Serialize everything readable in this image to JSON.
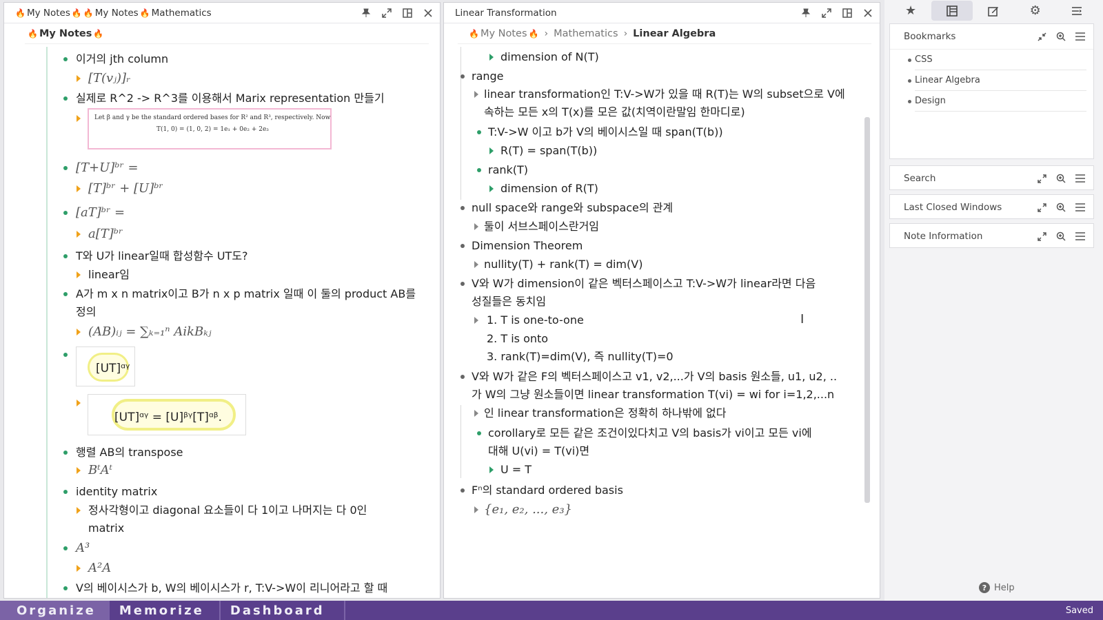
{
  "left_panel": {
    "title_parts": [
      "My Notes",
      "My Notes",
      "Mathematics"
    ],
    "breadcrumb": "My Notes",
    "rows": [
      {
        "text": "이거의 jth column"
      },
      {
        "text": "[T(vⱼ)]ᵣ"
      },
      {
        "text": "실제로 R^2 -> R^3를 이용해서 Marix representation 만들기"
      },
      {
        "text": "Let β and γ be the standard ordered bases for R² and R³, respectively. Now"
      },
      {
        "text": "T(1, 0) = (1, 0, 2) = 1e₁ + 0e₂ + 2e₃"
      },
      {
        "text": "[T+U]ᵇʳ ="
      },
      {
        "text": "[T]ᵇʳ + [U]ᵇʳ"
      },
      {
        "text": "[aT]ᵇʳ ="
      },
      {
        "text": "a[T]ᵇʳ"
      },
      {
        "text": "T와 U가 linear일때 합성함수 UT도?"
      },
      {
        "text": "linear임"
      },
      {
        "text": "A가 m x n matrix이고 B가 n x p matrix 일때 이 둘의 product AB를"
      },
      {
        "text": "정의"
      },
      {
        "text": "(AB)ᵢⱼ = ∑ₖ₌₁ⁿ AikBₖⱼ"
      },
      {
        "text": "[UT]ᵅᵞ"
      },
      {
        "text": "[UT]ᵅᵞ = [U]ᵝᵞ[T]ᵅᵝ."
      },
      {
        "text": "행렬 AB의 transpose"
      },
      {
        "text": "BᵗAᵗ"
      },
      {
        "text": "identity matrix"
      },
      {
        "text": "정사각형이고 diagonal 요소들이 다 1이고 나머지는 다 0인"
      },
      {
        "text": "matrix"
      },
      {
        "text": "A³"
      },
      {
        "text": "A²A"
      },
      {
        "text": "V의 베이시스가 b, W의 베이시스가 r, T:V->W이 리니어라고 할 때"
      }
    ]
  },
  "mid_panel": {
    "title": "Linear Transformation",
    "breadcrumb": {
      "root": "My Notes",
      "mid": "Mathematics",
      "current": "Linear Algebra"
    },
    "rows": [
      {
        "text": "dimension of N(T)"
      },
      {
        "text": "range"
      },
      {
        "text": "linear transformation인 T:V->W가 있을 때 R(T)는 W의 subset으로 V에"
      },
      {
        "text": "속하는 모든 x의 T(x)를 모은 값(치역이란말임 한마디로)"
      },
      {
        "text": "T:V->W 이고 b가 V의 베이시스일 때 span(T(b))"
      },
      {
        "text": "R(T) = span(T(b))"
      },
      {
        "text": "rank(T)"
      },
      {
        "text": "dimension of R(T)"
      },
      {
        "text": "null space와 range와 subspace의 관계"
      },
      {
        "text": "둘이 서브스페이스란거임"
      },
      {
        "text": "Dimension Theorem"
      },
      {
        "text": "nullity(T) + rank(T) = dim(V)"
      },
      {
        "text": "V와 W가 dimension이 같은 벡터스페이스고 T:V->W가 linear라면 다음"
      },
      {
        "text": "성질들은 동치임"
      },
      {
        "text": "1. T is one-to-one"
      },
      {
        "text": "2. T is onto"
      },
      {
        "text": "3. rank(T)=dim(V), 즉 nullity(T)=0"
      },
      {
        "text": "V와 W가 같은 F의 벡터스페이스고 v1, v2,...가 V의 basis 원소들, u1, u2, .."
      },
      {
        "text": "가 W의 그냥 원소들이면 linear transformation T(vi) = wi for i=1,2,...n"
      },
      {
        "text": "인 linear transformation은 정확히 하나밖에 없다"
      },
      {
        "text": "corollary로 모든 같은 조건이있다치고 V의 basis가 vi이고 모든 vi에"
      },
      {
        "text": "대해 U(vi) = T(vi)면"
      },
      {
        "text": "U = T"
      },
      {
        "text": "Fⁿ의 standard ordered basis"
      },
      {
        "text": "{e₁, e₂, ..., e₃}"
      }
    ]
  },
  "sidebar": {
    "widgets": {
      "bookmarks": {
        "title": "Bookmarks",
        "items": [
          "CSS",
          "Linear Algebra",
          "Design"
        ]
      },
      "search": {
        "title": "Search"
      },
      "last_closed": {
        "title": "Last Closed Windows"
      },
      "note_info": {
        "title": "Note Information"
      }
    },
    "help": "Help"
  },
  "bottom_bar": {
    "buttons": [
      "Organize",
      "Memorize",
      "Dashboard"
    ],
    "status": "Saved"
  }
}
